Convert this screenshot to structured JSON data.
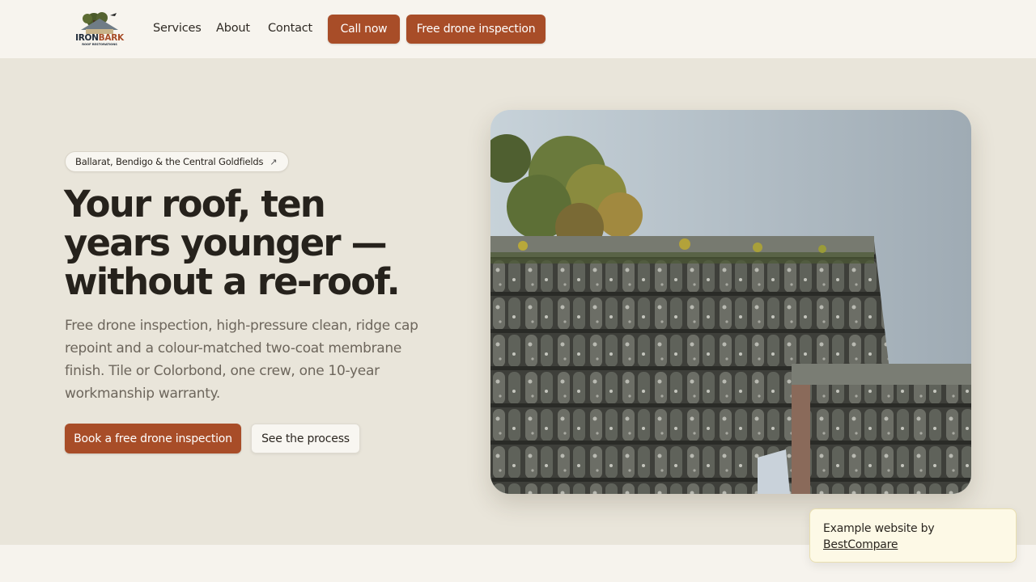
{
  "nav": {
    "logo_text": "IRONBARK",
    "logo_subtext": "ROOF RESTORATIONS",
    "links": [
      "Services",
      "About",
      "Contact"
    ],
    "call_label": "Call now",
    "inspection_label": "Free drone inspection"
  },
  "hero": {
    "location_pill": "Ballarat, Bendigo & the Central Goldfields",
    "pill_icon": "arrow-up-right-icon",
    "headline_lines": [
      "Your roof, ten",
      "years younger —",
      "without a re-roof."
    ],
    "lead": "Free drone inspection, high-pressure clean, ridge cap repoint and a colour-matched two-coat membrane finish. Tile or Colorbond, one crew, one 10-year workmanship warranty.",
    "primary_cta": "Book a free drone inspection",
    "secondary_cta": "See the process",
    "image_icon": "roof-tiles-photo"
  },
  "toast": {
    "line1": "Example website by",
    "link": "BestCompare"
  },
  "colors": {
    "accent": "#a84d28",
    "background": "#e9e5da",
    "nav_bg": "#f7f4ee",
    "toast_bg": "#fdf9e6"
  }
}
